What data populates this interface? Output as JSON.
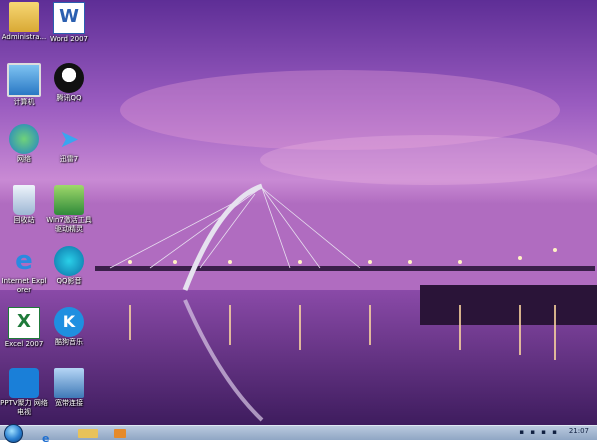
{
  "desktop": {
    "icons": [
      {
        "label": "Administra...",
        "icon": "user-folder-icon"
      },
      {
        "label": "Word 2007",
        "icon": "word-icon"
      },
      {
        "label": "计算机",
        "icon": "computer-icon"
      },
      {
        "label": "腾讯QQ",
        "icon": "qq-penguin-icon"
      },
      {
        "label": "网络",
        "icon": "network-icon"
      },
      {
        "label": "迅雷7",
        "icon": "thunder-bird-icon"
      },
      {
        "label": "回收站",
        "icon": "recycle-bin-icon"
      },
      {
        "label": "Win7激活工具驱动精灵",
        "icon": "tool-icon"
      },
      {
        "label": "Internet Explorer",
        "icon": "ie-icon"
      },
      {
        "label": "QQ影音",
        "icon": "qq-player-icon"
      },
      {
        "label": "Excel 2007",
        "icon": "excel-icon"
      },
      {
        "label": "酷狗音乐",
        "icon": "kugou-icon"
      },
      {
        "label": "PPTV聚力 网络电视",
        "icon": "pptv-icon"
      },
      {
        "label": "宽带连接",
        "icon": "broadband-icon"
      }
    ]
  },
  "taskbar": {
    "items": [
      "ie-icon",
      "explorer-folder-icon",
      "media-player-icon"
    ],
    "tray": "▪ ▪ ▪ ▪",
    "clock": "21:07"
  },
  "colors": {
    "taskbar": "#9fb3cf",
    "sky_top": "#6b3aa8",
    "sky_mid": "#b36fc9",
    "water": "#5a2a78"
  }
}
